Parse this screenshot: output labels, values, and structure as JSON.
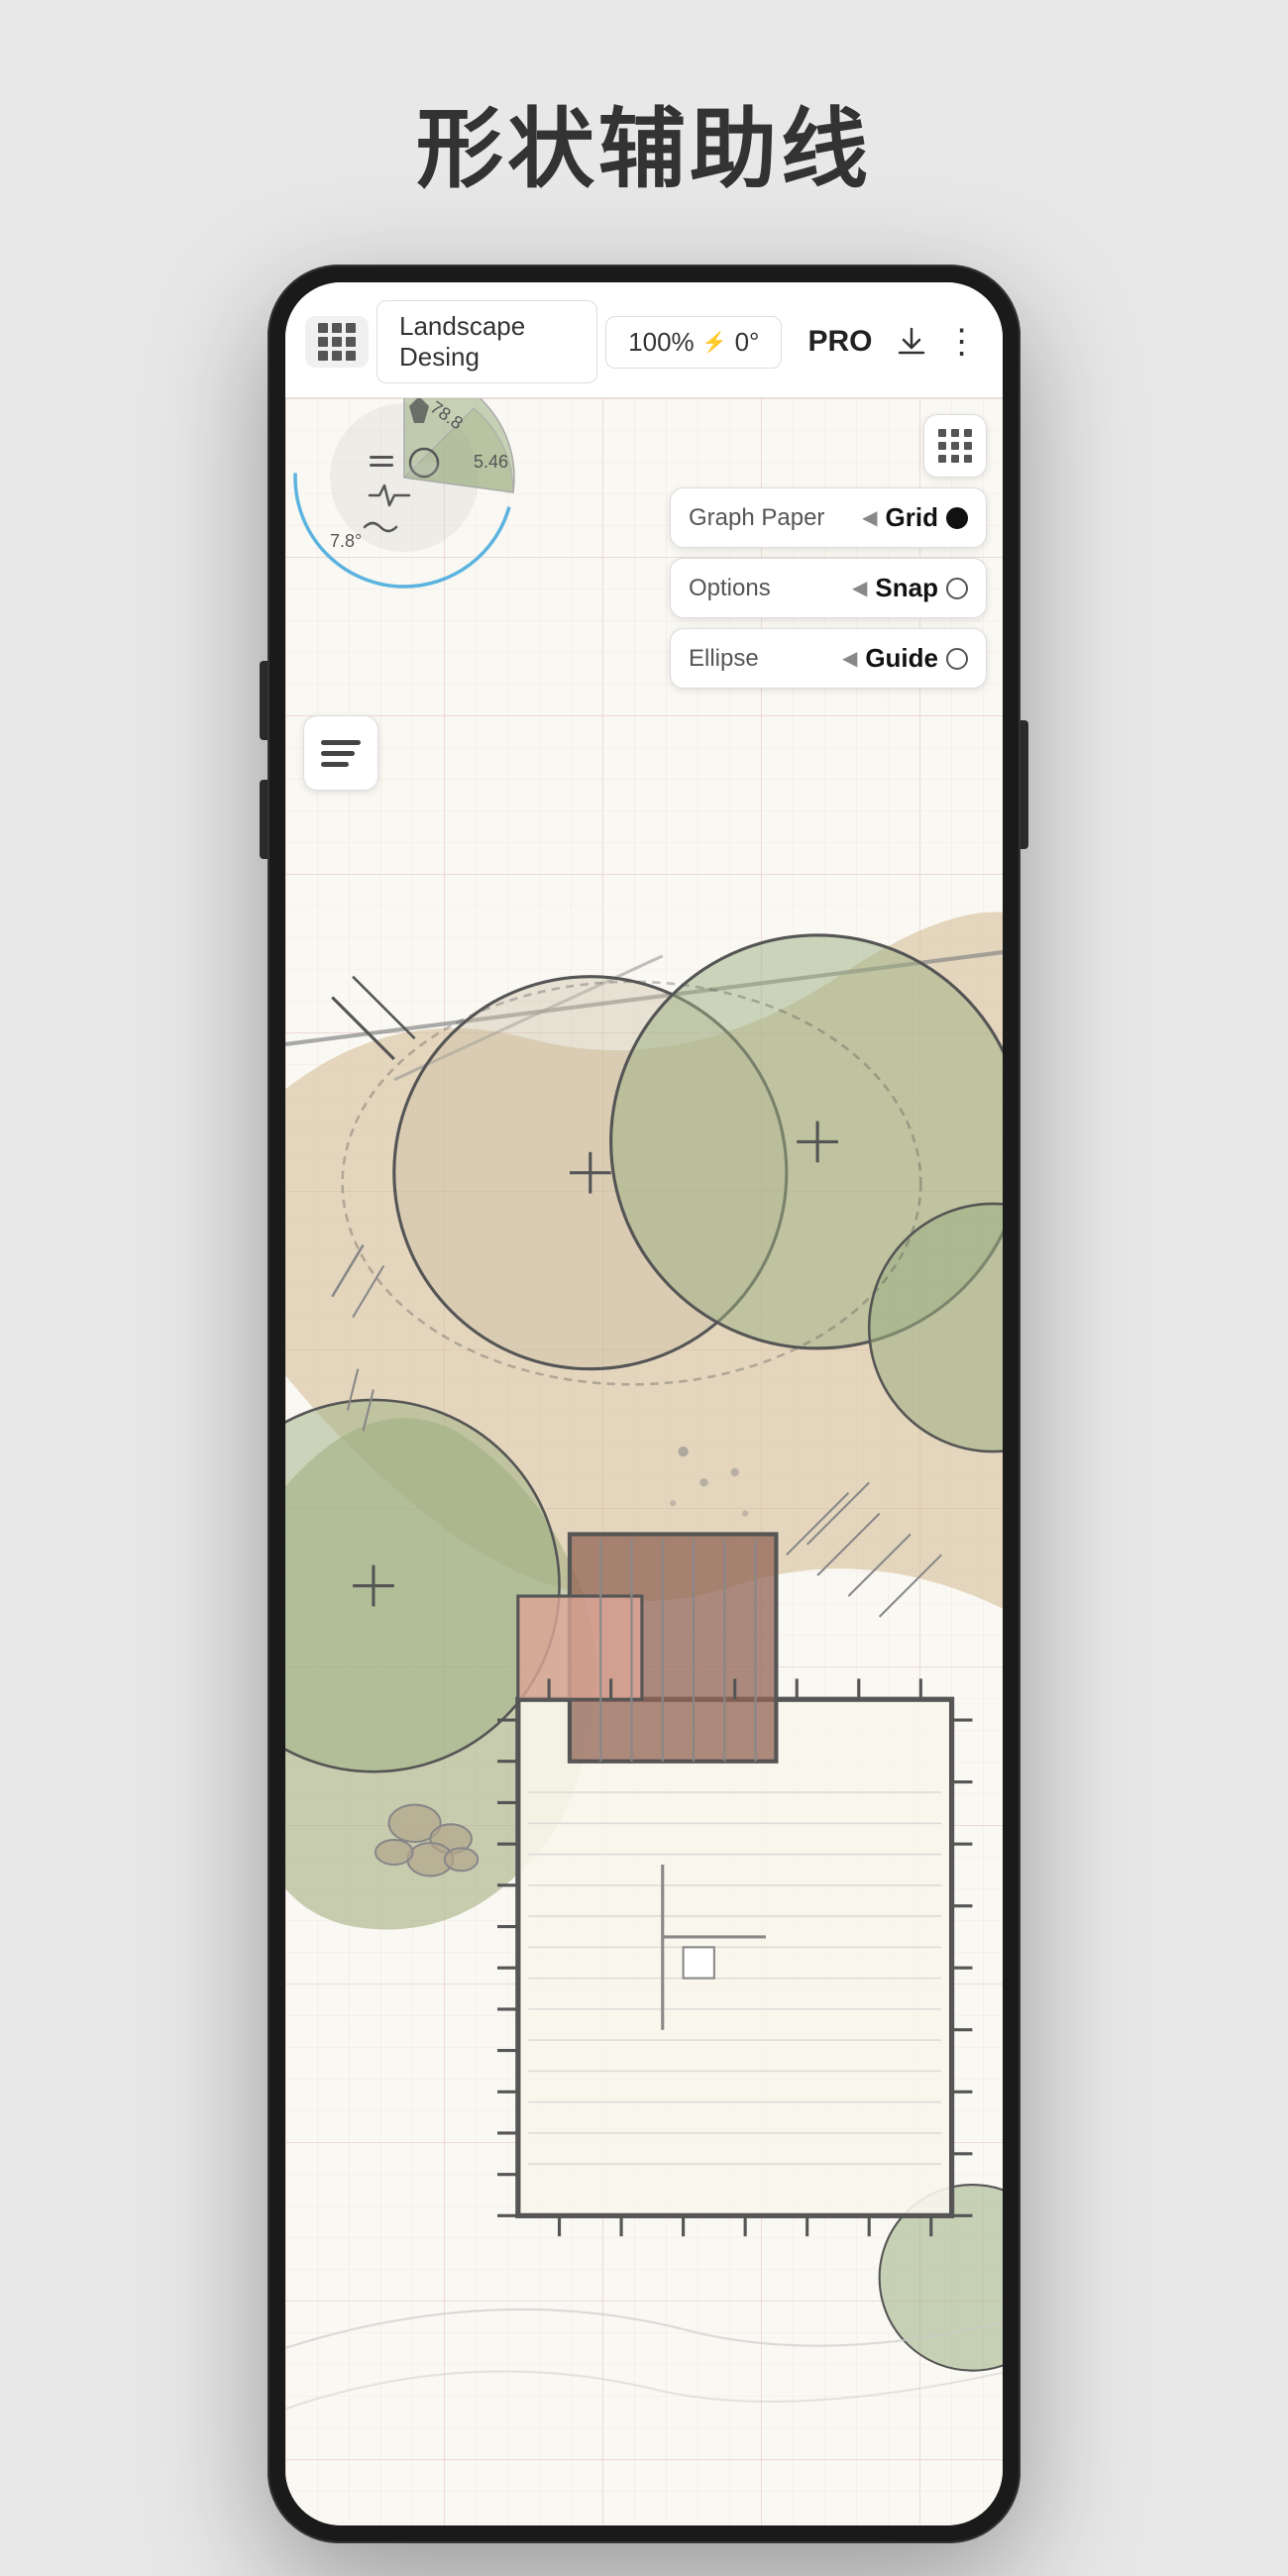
{
  "page": {
    "title": "形状辅助线",
    "bg_color": "#e8e8e8"
  },
  "topbar": {
    "doc_title": "Landscape Desing",
    "zoom_label": "100%",
    "rotation_label": "0°",
    "pro_label": "PRO",
    "more_icon": "⋮"
  },
  "panels": {
    "row1": {
      "left_label": "Graph Paper",
      "arrow": "◀",
      "right_label": "Grid",
      "indicator": "filled"
    },
    "row2": {
      "left_label": "Options",
      "arrow": "◀",
      "right_label": "Snap",
      "indicator": "empty"
    },
    "row3": {
      "left_label": "Ellipse",
      "arrow": "◀",
      "right_label": "Guide",
      "indicator": "empty"
    }
  },
  "rotation_values": {
    "top": "78.8",
    "side": "5.46",
    "bottom": "7.8°"
  }
}
